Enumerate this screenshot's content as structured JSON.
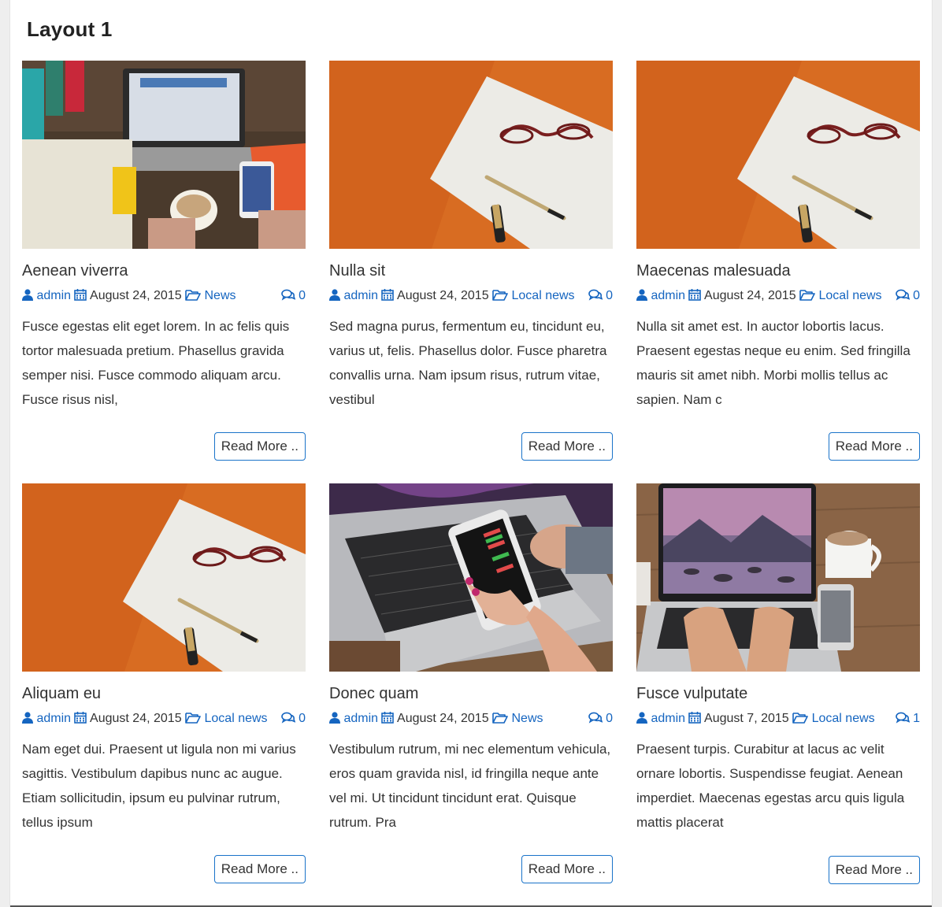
{
  "section": {
    "title": "Layout 1"
  },
  "posts": [
    {
      "title": "Aenean viverra",
      "author": "admin",
      "date": "August 24, 2015",
      "category": "News",
      "comments": "0",
      "excerpt": "Fusce egestas elit eget lorem. In ac felis quis tortor malesuada pretium. Phasellus gravida semper nisi. Fusce commodo aliquam arcu. Fusce risus nisl,",
      "read_more": "Read More ..",
      "image": "desk-laptop-coffee-phone"
    },
    {
      "title": "Nulla sit",
      "author": "admin",
      "date": "August 24, 2015",
      "category": "Local news",
      "comments": "0",
      "excerpt": "Sed magna purus, fermentum eu, tincidunt eu, varius ut, felis. Phasellus dolor. Fusce pharetra convallis urna. Nam ipsum risus, rutrum vitae, vestibul",
      "read_more": "Read More ..",
      "image": "paper-glasses-pen"
    },
    {
      "title": "Maecenas malesuada",
      "author": "admin",
      "date": "August 24, 2015",
      "category": "Local news",
      "comments": "0",
      "excerpt": "Nulla sit amet est. In auctor lobortis lacus. Praesent egestas neque eu enim. Sed fringilla mauris sit amet nibh. Morbi mollis tellus ac sapien. Nam c",
      "read_more": "Read More ..",
      "image": "paper-glasses-pen"
    },
    {
      "title": "Aliquam eu",
      "author": "admin",
      "date": "August 24, 2015",
      "category": "Local news",
      "comments": "0",
      "excerpt": "Nam eget dui. Praesent ut ligula non mi varius sagittis. Vestibulum dapibus nunc ac augue. Etiam sollicitudin, ipsum eu pulvinar rutrum, tellus ipsum",
      "read_more": "Read More ..",
      "image": "paper-glasses-pen"
    },
    {
      "title": "Donec quam",
      "author": "admin",
      "date": "August 24, 2015",
      "category": "News",
      "comments": "0",
      "excerpt": "Vestibulum rutrum, mi nec elementum vehicula, eros quam gravida nisl, id fringilla neque ante vel mi. Ut tincidunt tincidunt erat. Quisque rutrum. Pra",
      "read_more": "Read More ..",
      "image": "laptop-phone-trading"
    },
    {
      "title": "Fusce vulputate",
      "author": "admin",
      "date": "August 7, 2015",
      "category": "Local news",
      "comments": "1",
      "excerpt": "Praesent turpis. Curabitur at lacus ac velit ornare lobortis. Suspendisse feugiat. Aenean imperdiet. Maecenas egestas arcu quis ligula mattis placerat",
      "read_more": "Read More ..",
      "image": "macbook-mountain-lake"
    }
  ],
  "colors": {
    "link": "#1565c0",
    "button_border": "#1a73c9"
  }
}
